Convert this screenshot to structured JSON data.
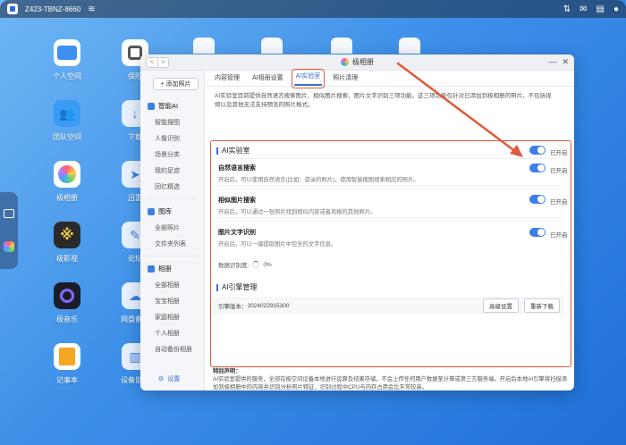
{
  "topbar": {
    "device_name": "Z423-TBNZ-8660"
  },
  "desktop": {
    "icons": [
      {
        "label": "个人空间"
      },
      {
        "label": "团队空间"
      },
      {
        "label": "极相册"
      },
      {
        "label": "极影视"
      },
      {
        "label": "极音乐"
      },
      {
        "label": "记事本"
      },
      {
        "label": "保险"
      },
      {
        "label": "下载"
      },
      {
        "label": "迅雷"
      },
      {
        "label": "论坛"
      },
      {
        "label": "网盘备份"
      },
      {
        "label": "设备监控"
      }
    ]
  },
  "window": {
    "title": "极相册",
    "nav_back": "<",
    "nav_forward": ">",
    "minimize": "—",
    "close": "✕"
  },
  "sidebar": {
    "add_button": "+ 添加照片",
    "group_ai": "智能AI",
    "ai_items": [
      "智能搜图",
      "人像识别",
      "场景分类",
      "我的足迹",
      "回忆精选"
    ],
    "group_library": "图库",
    "library_items": [
      "全部照片",
      "文件夹列表"
    ],
    "group_album": "相册",
    "album_items": [
      "全部相册",
      "宝宝相册",
      "家庭相册",
      "个人相册",
      "自动备份相册"
    ],
    "settings": "设置"
  },
  "tabs": [
    "内容管理",
    "AI相册设置",
    "AI实验室",
    "照片清理"
  ],
  "intro": "AI实验室目前提供自然语言搜索图片、相似图片搜索、图片文字识别三项功能。这三项功能仅针对已添加到极相册的照片，不包括视频以及其他无法支持预览的照片格式。",
  "ai_lab": {
    "title": "AI实验室",
    "master_toggle_label": "已开启",
    "features": [
      {
        "title": "自然语言搜索",
        "desc": "开启后，可以使用自然语言(比如：游泳的照片)，使用智能搜图搜索相应的照片。",
        "toggle_label": "已开启"
      },
      {
        "title": "相似图片搜索",
        "desc": "开启后，可以通过一张照片找到相似内容或者风格的其他照片。",
        "toggle_label": "已开启"
      },
      {
        "title": "图片文字识别",
        "desc": "开启后，可以一键提取图片中包含的文字信息。",
        "toggle_label": "已开启"
      }
    ],
    "progress_label": "数据识别度:",
    "progress_value": "0%"
  },
  "engine": {
    "title": "AI引擎管理",
    "version_label": "引擎版本：",
    "version": "2024022915300",
    "advanced_button": "高级设置",
    "redownload_button": "重新下载"
  },
  "notice": {
    "title": "特别声明：",
    "text": "AI实验室提供的服务，全部在极空间设备本地进行运算及结果存储，不会上传任何用户数据至计算或第三方服务端。开启后本地AI引擎将扫描添加到极相册中的内容并识别分析照片特征，识别过程中CPU与内存占用会比平常较高。"
  },
  "colors": {
    "accent": "#3d7fe6",
    "highlight": "#e05a3b",
    "desktop_bg": "#3c8fe8"
  }
}
